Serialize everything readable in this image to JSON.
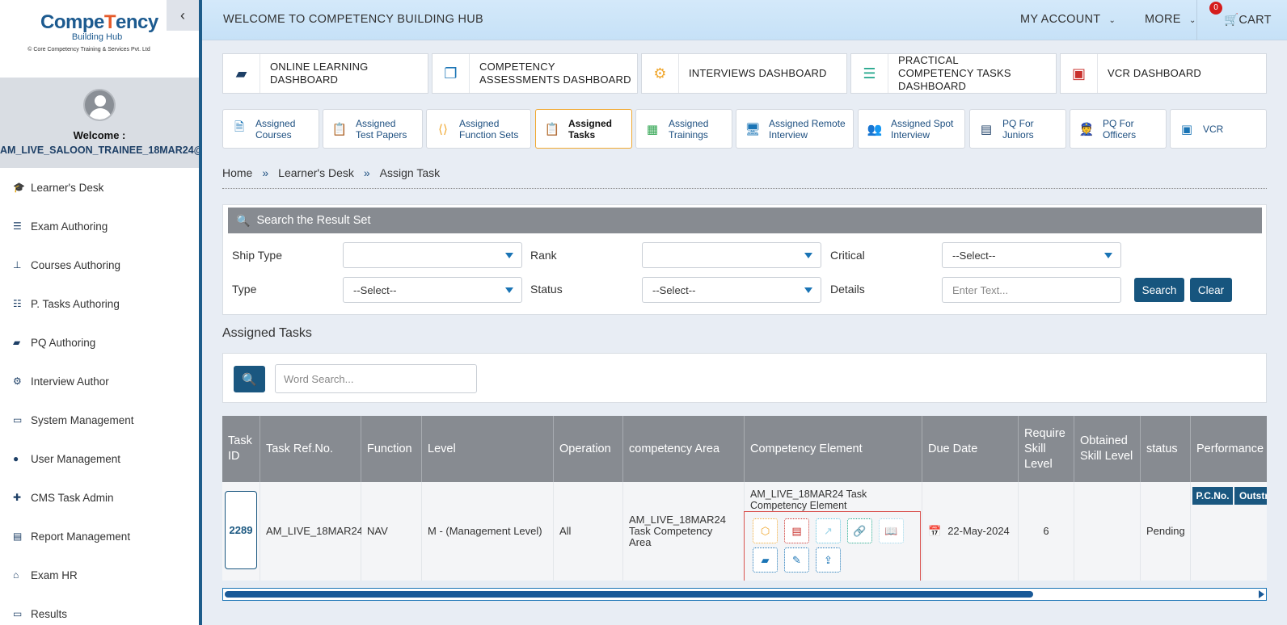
{
  "brand": {
    "name_pre": "Compe",
    "name_mid": "T",
    "name_post": "ency",
    "sub": "Building Hub",
    "copyright": "© Core Competency Training & Services Pvt. Ltd"
  },
  "profile": {
    "welcome": "Welcome :",
    "username": "AM_LIVE_SALOON_TRAINEE_18MAR24@"
  },
  "menu": [
    {
      "icon": "graduation-cap-icon",
      "label": "Learner's Desk"
    },
    {
      "icon": "list-icon",
      "label": "Exam Authoring"
    },
    {
      "icon": "sitemap-icon",
      "label": "Courses Authoring"
    },
    {
      "icon": "tasks-icon",
      "label": "P. Tasks Authoring"
    },
    {
      "icon": "book-icon",
      "label": "PQ Authoring"
    },
    {
      "icon": "cogs-icon",
      "label": "Interview Author"
    },
    {
      "icon": "desktop-icon",
      "label": "System Management"
    },
    {
      "icon": "user-icon",
      "label": "User Management"
    },
    {
      "icon": "user-plus-icon",
      "label": "CMS Task Admin"
    },
    {
      "icon": "report-icon",
      "label": "Report Management"
    },
    {
      "icon": "bank-icon",
      "label": "Exam HR"
    },
    {
      "icon": "monitor-icon",
      "label": "Results"
    }
  ],
  "topbar": {
    "title": "WELCOME TO COMPETENCY BUILDING HUB",
    "account": "MY ACCOUNT",
    "more": "MORE",
    "cart": "CART",
    "cart_count": "0"
  },
  "dashboards": [
    {
      "label": "ONLINE LEARNING DASHBOARD"
    },
    {
      "label": "COMPETENCY ASSESSMENTS DASHBOARD"
    },
    {
      "label": "INTERVIEWS DASHBOARD"
    },
    {
      "label": "PRACTICAL COMPETENCY TASKS DASHBOARD"
    },
    {
      "label": "VCR DASHBOARD"
    }
  ],
  "tabs": [
    {
      "label": "Assigned Courses"
    },
    {
      "label": "Assigned Test Papers"
    },
    {
      "label": "Assigned Function Sets"
    },
    {
      "label": "Assigned Tasks"
    },
    {
      "label": "Assigned Trainings"
    },
    {
      "label": "Assigned Remote Interview"
    },
    {
      "label": "Assigned Spot Interview"
    },
    {
      "label": "PQ For Juniors"
    },
    {
      "label": "PQ For Officers"
    },
    {
      "label": "VCR"
    }
  ],
  "breadcrumb": {
    "home": "Home",
    "sep": "»",
    "desk": "Learner's Desk",
    "current": "Assign Task"
  },
  "search": {
    "header": "Search the Result Set",
    "ship_type_label": "Ship Type",
    "ship_type_value": "",
    "rank_label": "Rank",
    "rank_value": "",
    "critical_label": "Critical",
    "critical_value": "--Select--",
    "type_label": "Type",
    "type_value": "--Select--",
    "status_label": "Status",
    "status_value": "--Select--",
    "details_label": "Details",
    "details_placeholder": "Enter Text...",
    "search_btn": "Search",
    "clear_btn": "Clear"
  },
  "assigned": {
    "title": "Assigned Tasks",
    "word_placeholder": "Word Search..."
  },
  "table": {
    "headers": [
      "Task ID",
      "Task Ref.No.",
      "Function",
      "Level",
      "Operation",
      "competency Area",
      "Competency Element",
      "Due Date",
      "Require Skill Level",
      "Obtained Skill Level",
      "status",
      "Performance"
    ],
    "row": {
      "task_id": "2289",
      "ref": "AM_LIVE_18MAR24",
      "function": "NAV",
      "level": "M - (Management Level)",
      "operation": "All",
      "area": "AM_LIVE_18MAR24 Task Competency Area",
      "element": "AM_LIVE_18MAR24 Task Competency Element",
      "due": "22-May-2024",
      "req": "6",
      "obt": "",
      "status": "Pending",
      "perf_pc": "P.C.No.",
      "perf_out": "Outstr"
    }
  },
  "colors": {
    "primary": "#1a5780",
    "header_gray": "#878b91",
    "accent_orange": "#f0a830",
    "border_red": "#d9534f"
  }
}
